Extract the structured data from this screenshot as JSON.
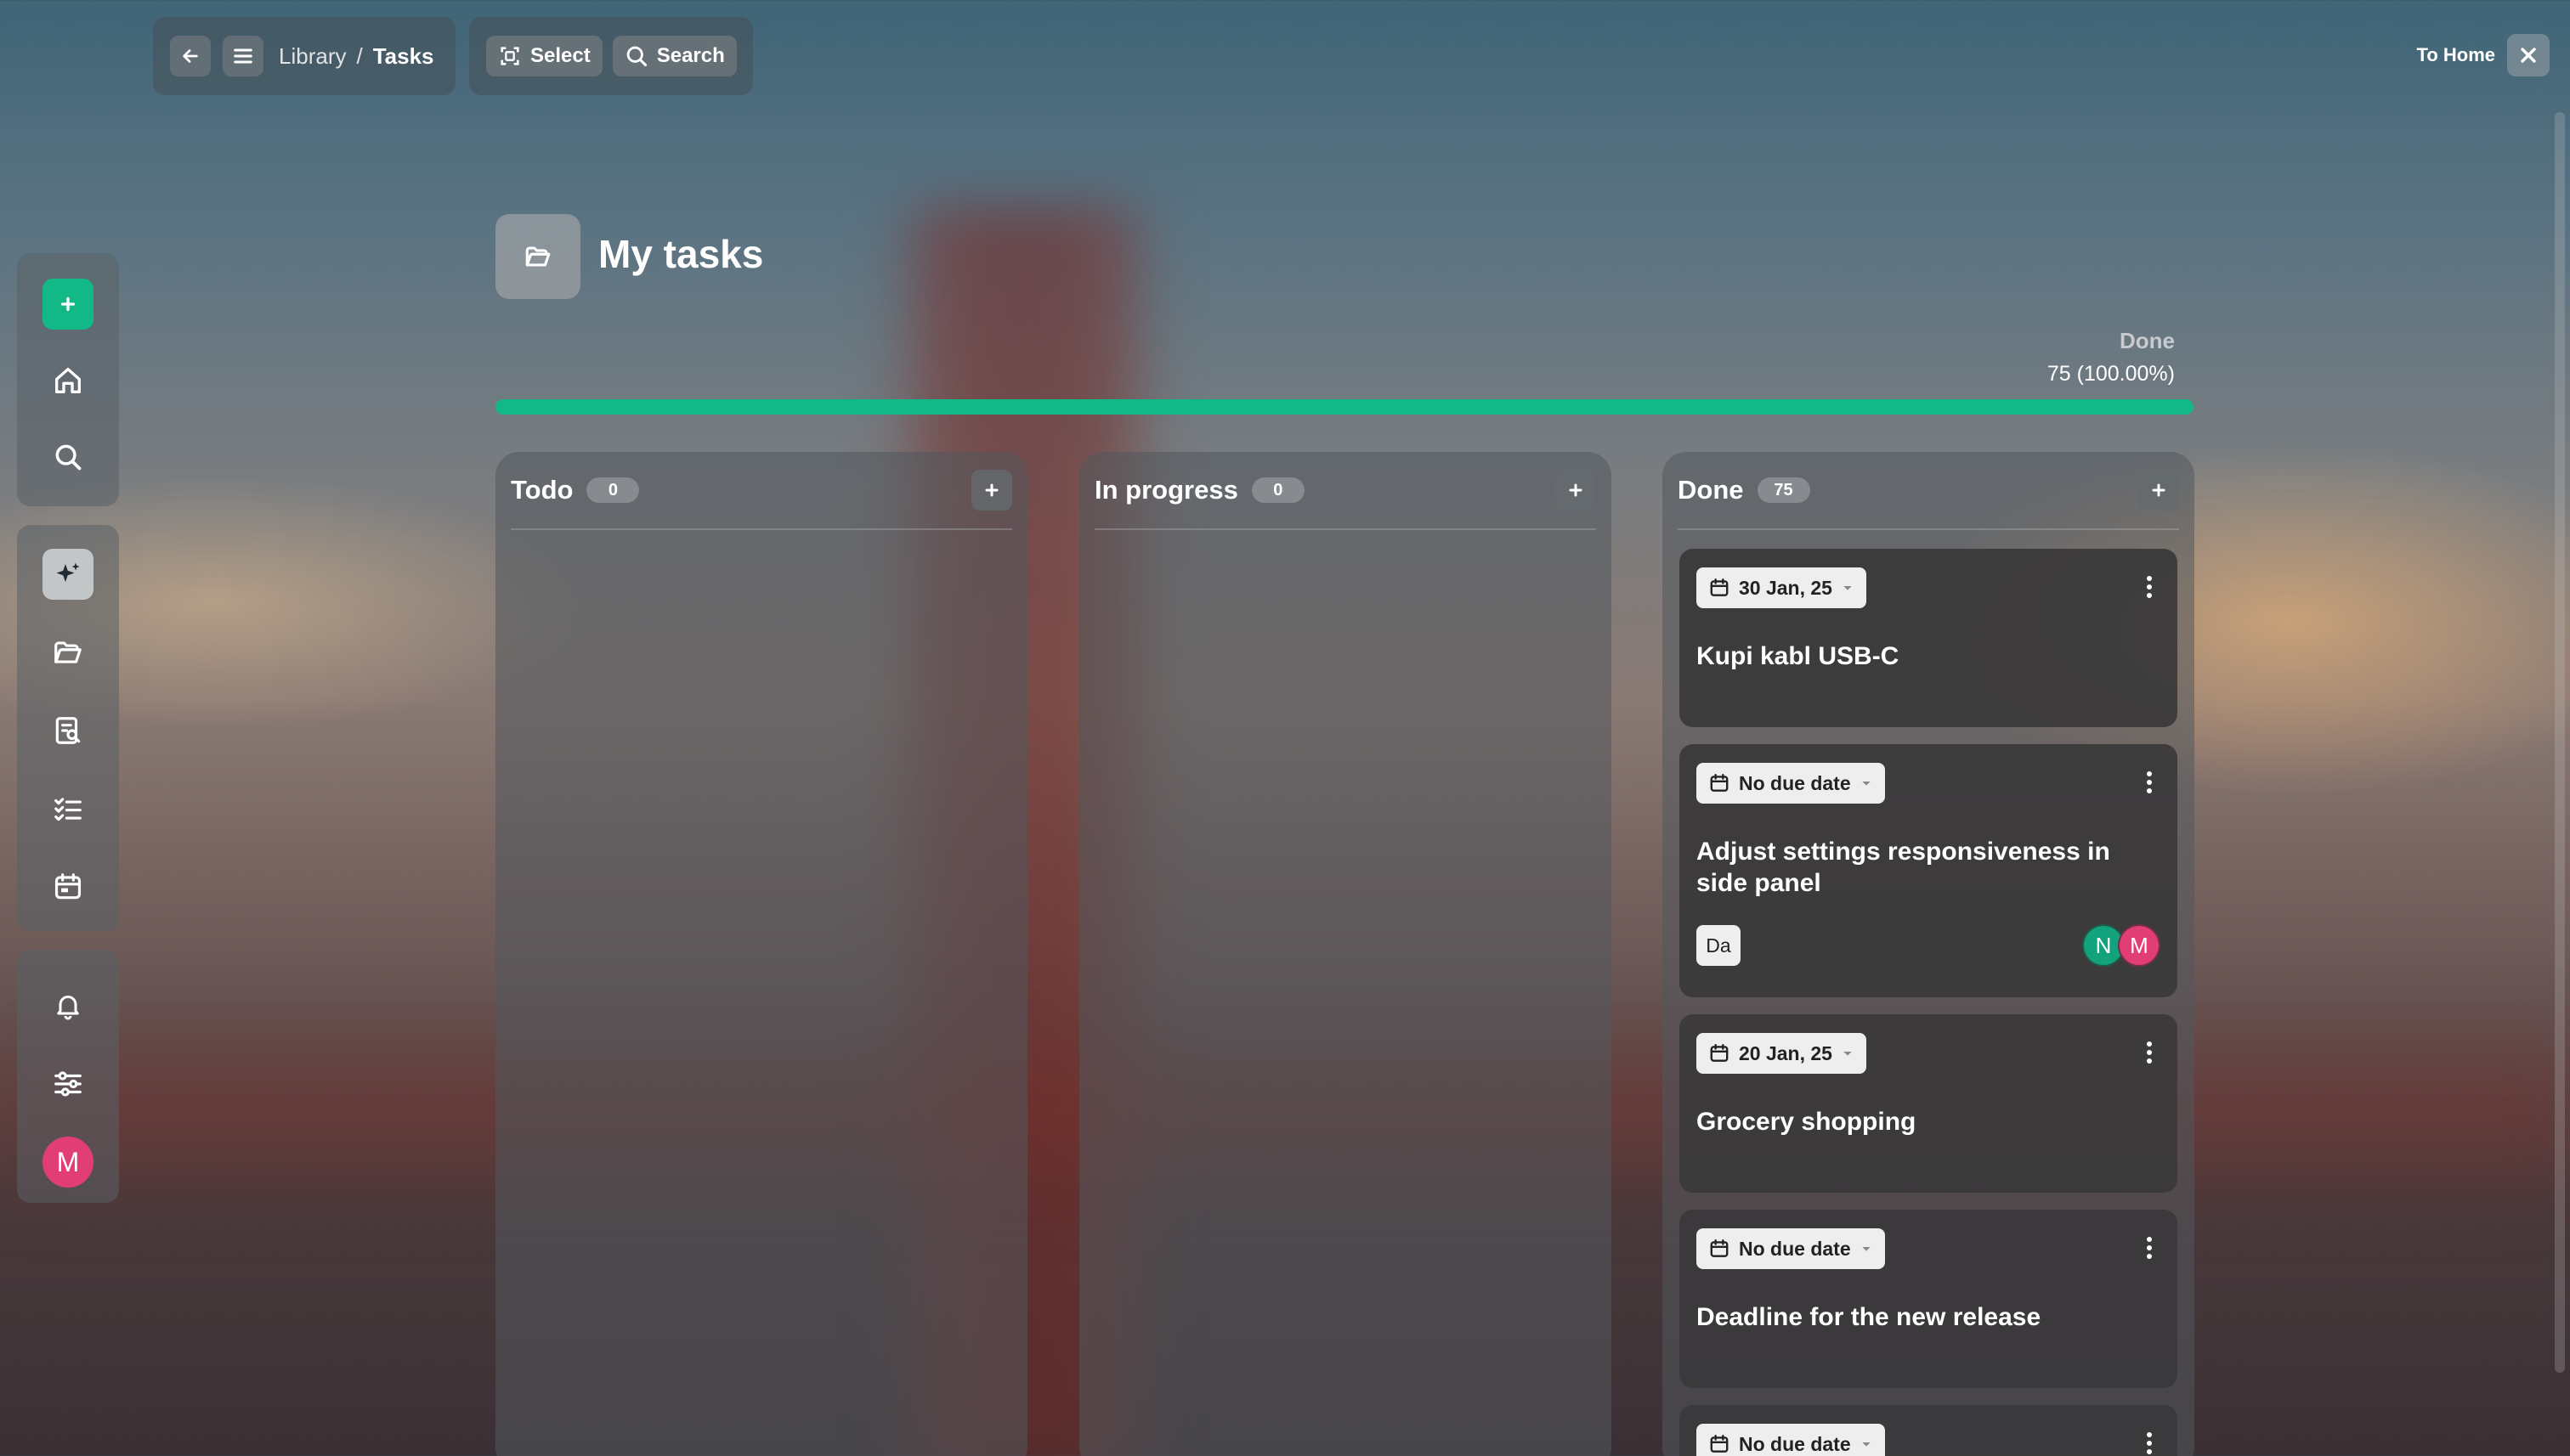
{
  "topbar": {
    "breadcrumb": {
      "library": "Library",
      "separator": "/",
      "current": "Tasks"
    },
    "select_label": "Select",
    "search_label": "Search",
    "to_home_label": "To Home"
  },
  "sidebar": {
    "items": [
      {
        "icon": "plus-icon"
      },
      {
        "icon": "home-icon"
      },
      {
        "icon": "search-icon"
      },
      {
        "icon": "sparkles-icon"
      },
      {
        "icon": "folder-open-icon"
      },
      {
        "icon": "document-search-icon"
      },
      {
        "icon": "task-list-icon"
      },
      {
        "icon": "calendar-icon"
      },
      {
        "icon": "bell-icon"
      },
      {
        "icon": "sliders-icon"
      }
    ],
    "avatar_letter": "M"
  },
  "page": {
    "title": "My tasks",
    "progress_label": "Done",
    "progress_value": "75 (100.00%)",
    "progress_fraction": 1.0,
    "accent_color": "#12b886"
  },
  "columns": [
    {
      "title": "Todo",
      "count": "0"
    },
    {
      "title": "In progress",
      "count": "0"
    },
    {
      "title": "Done",
      "count": "75"
    }
  ],
  "done_cards": [
    {
      "date": "30 Jan, 25",
      "title": "Kupi kabl USB-C"
    },
    {
      "date": "No due date",
      "title": "Adjust settings responsiveness in side panel",
      "tag": "Da",
      "avatars": [
        "N",
        "M"
      ]
    },
    {
      "date": "20 Jan, 25",
      "title": "Grocery shopping"
    },
    {
      "date": "No due date",
      "title": "Deadline for the new release"
    },
    {
      "date": "No due date",
      "title": ""
    }
  ]
}
